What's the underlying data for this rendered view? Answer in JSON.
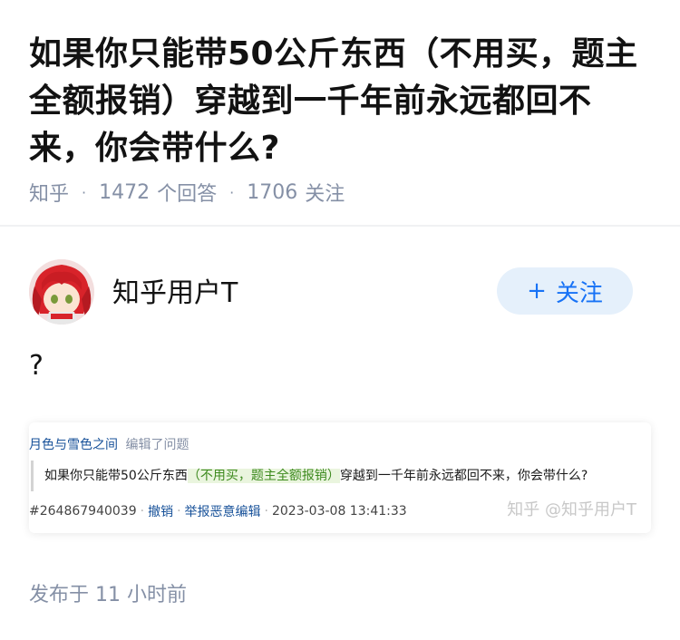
{
  "question": {
    "title": "如果你只能带50公斤东西（不用买，题主全额报销）穿越到一千年前永远都回不来，你会带什么?",
    "source": "知乎",
    "answer_count": "1472",
    "answer_label": "个回答",
    "follower_count": "1706",
    "follower_label": "关注"
  },
  "author": {
    "name": "知乎用户T",
    "follow_icon": "+",
    "follow_label": "关注"
  },
  "answer": {
    "content": "?"
  },
  "edit_log": {
    "editor": "月色与雪色之间",
    "action": "编辑了问题",
    "text_before": "如果你只能带50公斤东西",
    "text_highlight": "（不用买，题主全额报销）",
    "text_after": "穿越到一千年前永远都回不来，你会带什么?",
    "id": "#264867940039",
    "undo_label": "撤销",
    "report_label": "举报恶意编辑",
    "timestamp": "2023-03-08 13:41:33",
    "watermark": "知乎 @知乎用户T"
  },
  "published": {
    "label": "发布于",
    "time": "11 小时前"
  },
  "colors": {
    "accent": "#1772f6",
    "link": "#175199",
    "meta_gray": "#8590a6",
    "highlight_bg": "#eaf5de",
    "highlight_text": "#3d8a1e"
  }
}
